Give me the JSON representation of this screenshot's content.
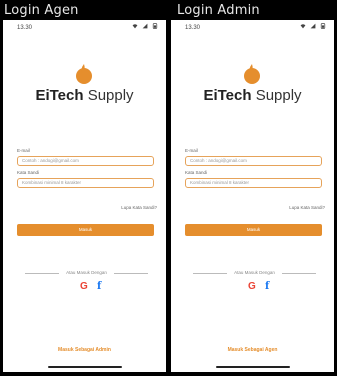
{
  "panels": [
    {
      "title": "Login Agen",
      "status_time": "13.30",
      "brand_bold": "EiTech",
      "brand_light": "Supply",
      "email_label": "E-mail",
      "email_placeholder": "Contoh : andogi@gmail.com",
      "password_label": "Kata Sandi",
      "password_placeholder": "Kombinasi minimal 8 karakter",
      "forgot_label": "Lupa Kata Sandi?",
      "submit_label": "Masuk",
      "divider_text": "Atau Masuk Dengan",
      "bottom_link": "Masuk Sebagai Admin"
    },
    {
      "title": "Login Admin",
      "status_time": "13.30",
      "brand_bold": "EiTech",
      "brand_light": "Supply",
      "email_label": "E-mail",
      "email_placeholder": "Contoh : andogi@gmail.com",
      "password_label": "Kata Sandi",
      "password_placeholder": "Kombinasi minimal 8 karakter",
      "forgot_label": "Lupa Kata Sandi?",
      "submit_label": "Masuk",
      "divider_text": "Atau Masuk Dengan",
      "bottom_link": "Masuk Sebagai Agen"
    }
  ],
  "social": {
    "google": "G",
    "facebook": "f"
  },
  "colors": {
    "accent": "#e58e2d",
    "input_border": "#e6a35a"
  }
}
